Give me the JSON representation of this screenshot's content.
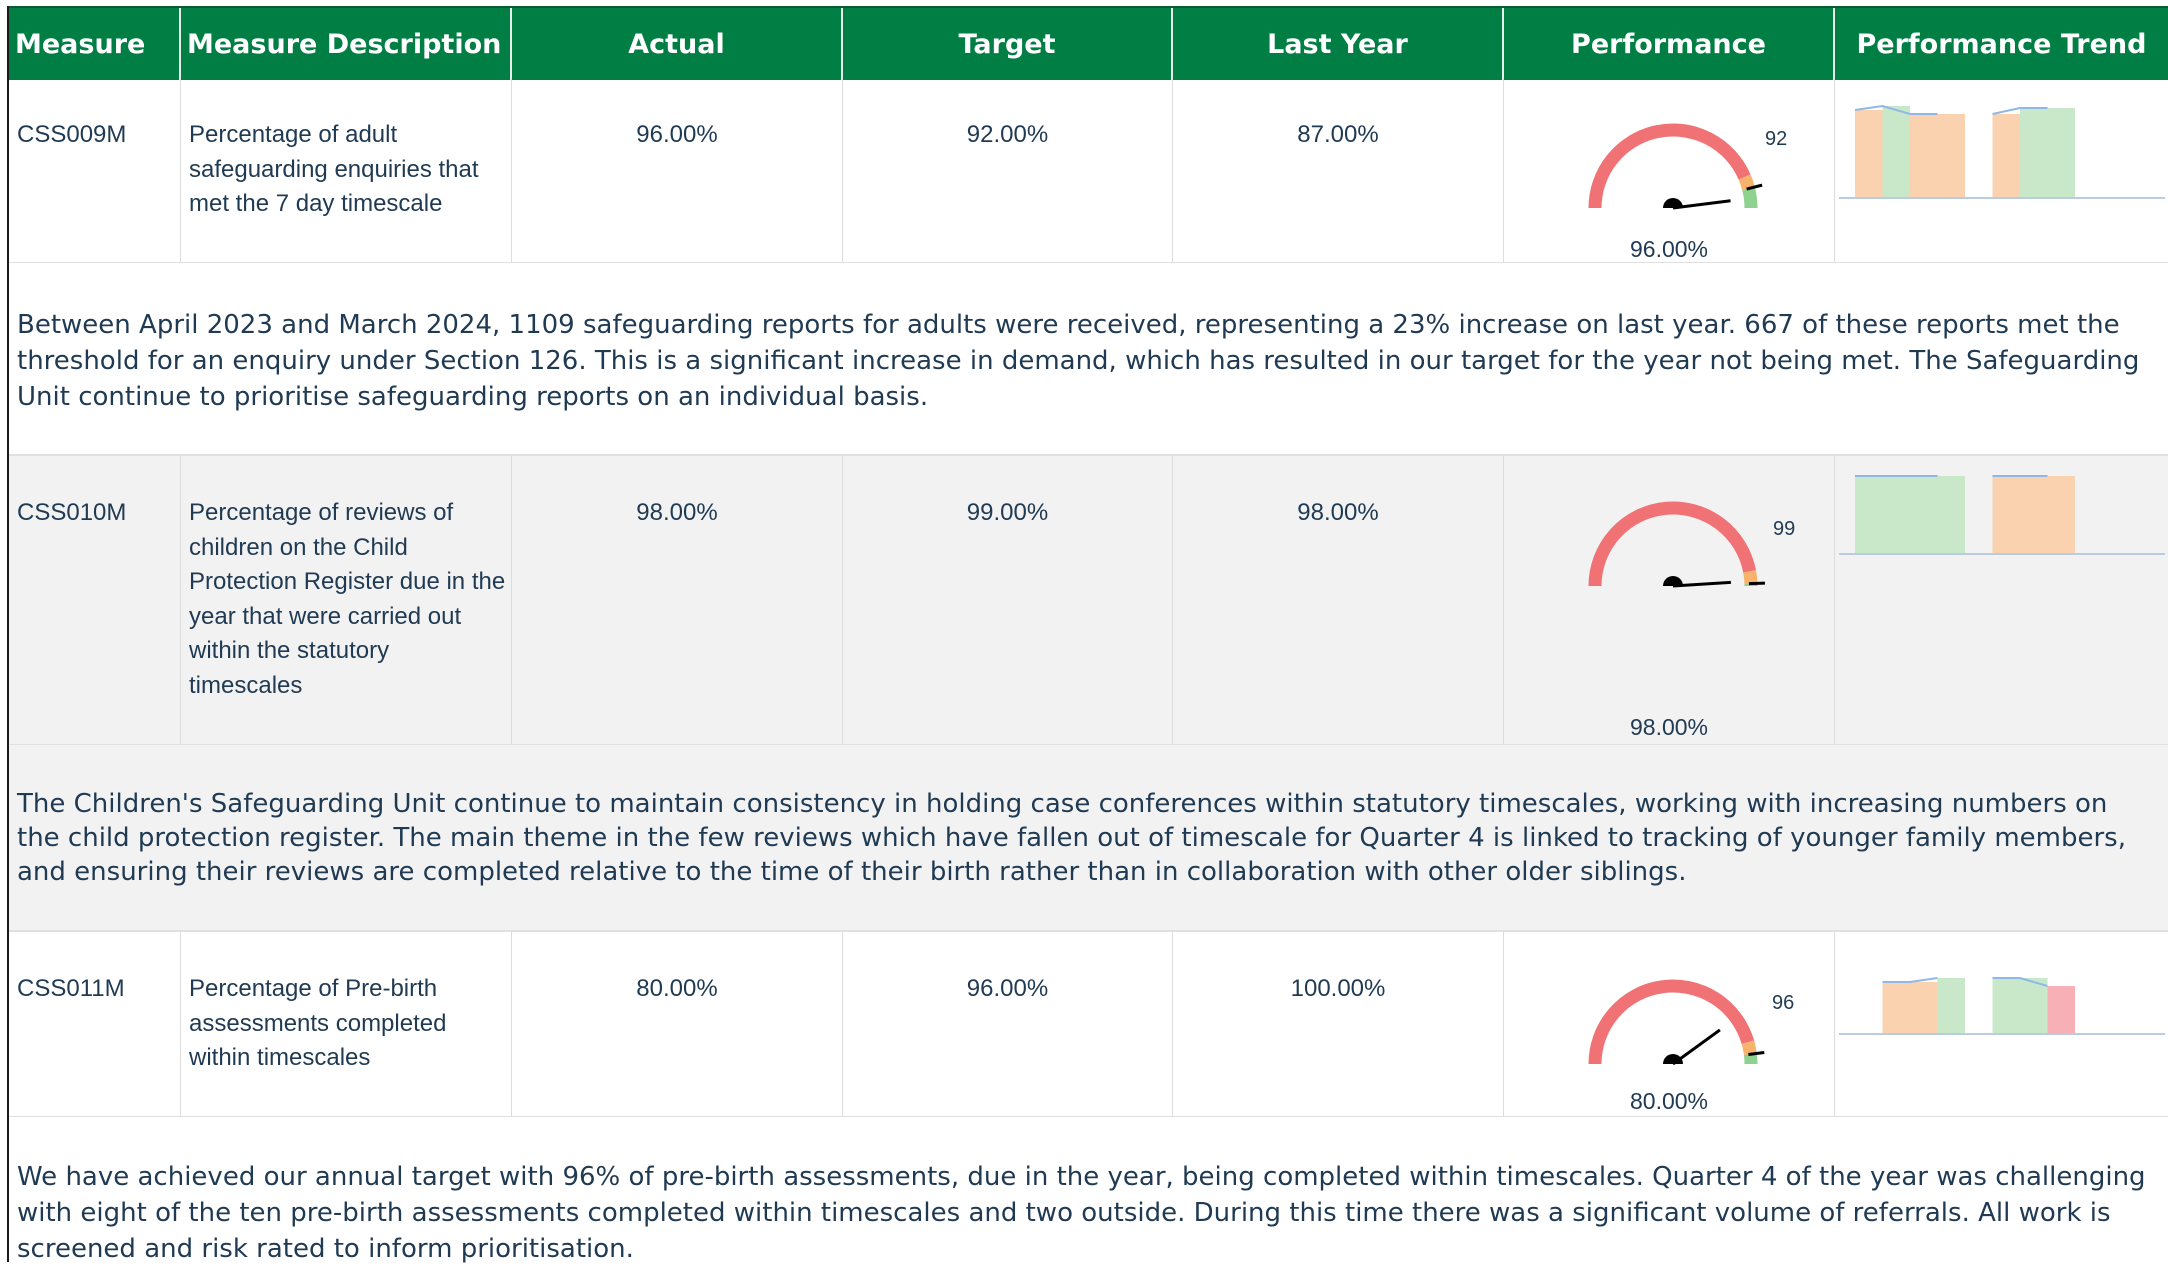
{
  "header": {
    "measure": "Measure",
    "description": "Measure Description",
    "actual": "Actual",
    "target": "Target",
    "last_year": "Last Year",
    "performance": "Performance",
    "trend": "Performance Trend"
  },
  "colors": {
    "header_bg": "#007e44",
    "gauge_red": "#f07275",
    "gauge_amber": "#f7b26b",
    "gauge_green": "#8fd18f",
    "trend_amber": "#fbd2b0",
    "trend_green": "#c9e8c9",
    "trend_red": "#f7b0b6",
    "trend_line": "#8fb8e8"
  },
  "rows": [
    {
      "measure": "CSS009M",
      "description": "Percentage of adult safeguarding enquiries that met the 7 day timescale",
      "actual": "96.00%",
      "target": "92.00%",
      "last_year": "87.00%",
      "gauge": {
        "value": 96,
        "target": 92,
        "target_label": "92",
        "value_label": "96.00%"
      },
      "trend": [
        "amber",
        "green",
        "amber",
        "amber",
        "gap",
        "amber",
        "green",
        "green"
      ],
      "commentary": "Between April 2023 and March 2024, 1109 safeguarding reports for adults were received, representing a 23% increase on last year. 667 of these reports met the threshold for an enquiry under Section 126. This is a significant increase in demand, which has resulted in our target for the year not being met. The Safeguarding Unit continue to prioritise safeguarding reports on an individual basis."
    },
    {
      "measure": "CSS010M",
      "description": "Percentage of reviews of children on the Child Protection Register due in the year that were carried out within the statutory timescales",
      "actual": "98.00%",
      "target": "99.00%",
      "last_year": "98.00%",
      "gauge": {
        "value": 98,
        "target": 99,
        "target_label": "99",
        "value_label": "98.00%"
      },
      "trend": [
        "green",
        "green",
        "green",
        "green",
        "gap",
        "amber",
        "amber",
        "amber"
      ],
      "commentary": "The Children's Safeguarding Unit continue to maintain consistency in holding case conferences within statutory timescales, working with increasing numbers on the child protection register. The main theme in the few reviews which have fallen out of timescale for Quarter 4 is linked to tracking of younger family members, and ensuring their reviews are completed relative to the time of their birth rather than in collaboration with other older siblings."
    },
    {
      "measure": "CSS011M",
      "description": "Percentage of Pre-birth assessments completed within timescales",
      "actual": "80.00%",
      "target": "96.00%",
      "last_year": "100.00%",
      "gauge": {
        "value": 80,
        "target": 96,
        "target_label": "96",
        "value_label": "80.00%"
      },
      "trend": [
        "gap",
        "amber",
        "amber",
        "green",
        "gap",
        "green",
        "green",
        "red"
      ],
      "commentary": "We have achieved our annual target with 96% of pre-birth assessments, due in the year, being completed within timescales.  Quarter 4 of the year was challenging with eight of the ten pre-birth assessments completed within timescales and two outside.  During this time there was a significant volume of referrals.  All work is screened and risk rated to inform prioritisation."
    }
  ]
}
